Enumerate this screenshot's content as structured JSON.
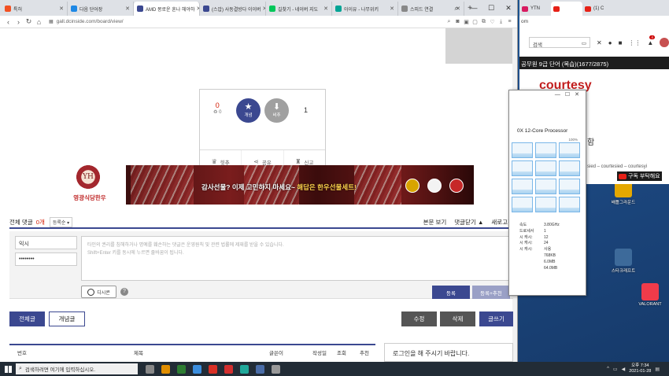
{
  "main_browser": {
    "tabs": [
      {
        "label": "특허",
        "color": "#f25022"
      },
      {
        "label": "다음 단어장",
        "color": "#1e88e5"
      },
      {
        "label": "AMD 몽로운 혼나 헤야하",
        "color": "#3b4890"
      },
      {
        "label": "(스압) 사동결방다 이이버",
        "color": "#3b4890"
      },
      {
        "label": "길찾기 - 네이버 지도",
        "color": "#03c75a"
      },
      {
        "label": "아이유 - 나무위키",
        "color": "#00a495"
      },
      {
        "label": "스피드 연결",
        "color": "#888888"
      }
    ],
    "url": "gall.dcinside.com/board/view/"
  },
  "recommend": {
    "up_count": "0",
    "fixed_count": "0",
    "up_label": "개념",
    "down_label": "비추",
    "down_count": "1",
    "actions": [
      "힛추",
      "공유",
      "신고"
    ]
  },
  "ad": {
    "brand": "영광식당한우",
    "slogan_part1": "감사선물? 이제 고민하지 마세요~ ",
    "slogan_part2": "해답은 한우선물세트!"
  },
  "comments": {
    "title": "전체 댓글",
    "count": "0개",
    "sort": "등록순",
    "view_text": "본문 보기",
    "close_text": "댓글닫기 ▲",
    "refresh_text": "새로고침",
    "name_value": "익시",
    "password_value": "••••••••",
    "notice_line1": "타인의 권리를 침해하거나 명예를 훼손하는 댓글은 운영원칙 및 관련 법률에 제재를 받을 수 있습니다.",
    "notice_line2": "Shift+Enter 키를 동시에 누르면 줄바꿈이 됩니다.",
    "dcicon_label": "디시콘",
    "submit_label": "등록",
    "submit_rec_label": "등록+추천"
  },
  "board_buttons": {
    "all": "전체글",
    "concept": "개념글",
    "edit": "수정",
    "delete": "삭제",
    "write": "글쓰기"
  },
  "list_header": {
    "no": "번호",
    "title": "제목",
    "writer": "글쓴이",
    "date": "작성일",
    "views": "조회",
    "rec": "추천"
  },
  "login_prompt": "로그인을 해 주시기 바랍니다.",
  "youtube": {
    "tabs": [
      "YTN",
      "",
      "(1) C"
    ],
    "url": "om",
    "search_placeholder": "검색",
    "notification_count": "4",
    "video_title": "공무원 9급 단어 (복습)(1677/2875)",
    "word": "courtesy",
    "bracket": "]",
    "meaning_fragment": "함",
    "forms": "sied – courtesied – courtesyi",
    "subscribe": "구독 부탁해요"
  },
  "task_manager": {
    "cpu_name": "0X 12-Core Processor",
    "percent_label": "100%",
    "stat_labels": [
      "속도",
      "",
      "",
      "드로세서",
      "",
      "시 캐시:",
      "시 캐시:",
      "시 캐시:"
    ],
    "stat_values": [
      "3.80GHz",
      "1",
      "12",
      "24",
      "사용",
      "768KB",
      "6.0MB",
      "64.0MB"
    ]
  },
  "desktop_icons": [
    {
      "label": "배틀그라운드",
      "name": "pubg"
    },
    {
      "label": "스타크래프트",
      "name": "starcraft"
    },
    {
      "label": "VALORANT",
      "name": "valorant"
    }
  ],
  "taskbar": {
    "search_placeholder": "검색하려면 여기에 입력하십시오.",
    "time": "오후 7:34",
    "date": "2021-01-28",
    "apps": [
      "#888888",
      "#e08e00",
      "#2d7d32",
      "#3b8ede",
      "#d93025",
      "#d32f2f",
      "#1fa89a",
      "#4a6da8",
      "#999999"
    ]
  }
}
